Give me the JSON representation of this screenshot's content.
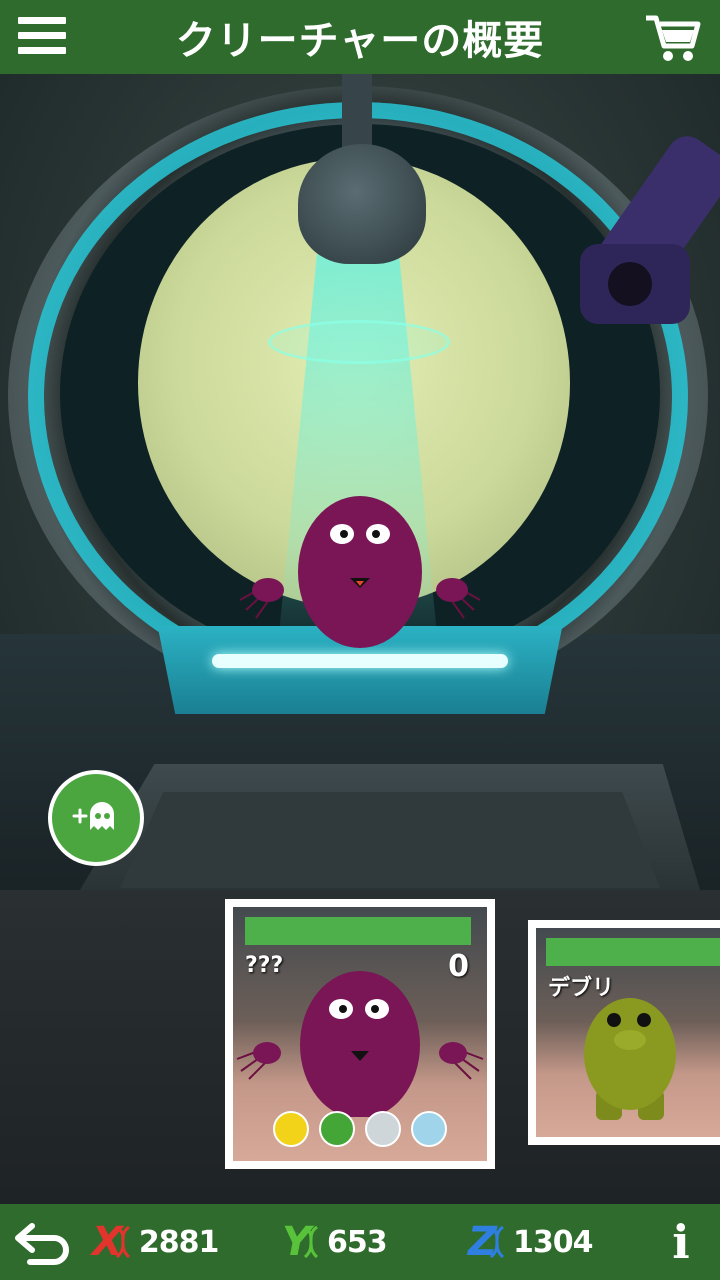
{
  "header": {
    "title": "クリーチャーの概要",
    "menu_icon": "hamburger-menu-icon",
    "cart_icon": "shopping-cart-icon"
  },
  "scene": {
    "add_creature_icon": "add-creature-icon",
    "colors": {
      "beam": "#6ef0dc",
      "ring_glow": "#27c5d6",
      "creature": "#7a1556"
    }
  },
  "cards": [
    {
      "name": "???",
      "count": "0",
      "elements": [
        "lightning-element-icon",
        "leaf-element-icon",
        "cloud-element-icon",
        "ice-element-icon"
      ]
    },
    {
      "name": "デブリ"
    }
  ],
  "footer": {
    "back_icon": "back-arrow-icon",
    "stats": [
      {
        "letter": "X",
        "icon": "x-dna-icon",
        "value": "2881",
        "color": "#e0342c"
      },
      {
        "letter": "Y",
        "icon": "y-dna-icon",
        "value": "653",
        "color": "#58c23a"
      },
      {
        "letter": "Z",
        "icon": "z-dna-icon",
        "value": "1304",
        "color": "#2f7fe0"
      }
    ],
    "info_label": "i"
  }
}
